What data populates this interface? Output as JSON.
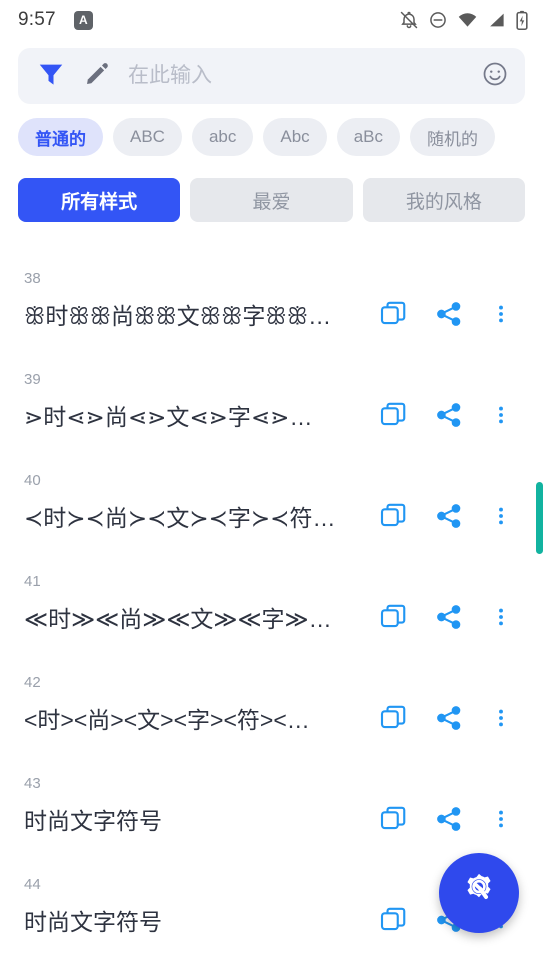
{
  "status_bar": {
    "time": "9:57",
    "badge_letter": "A",
    "icons": [
      "bell-off-icon",
      "do-not-disturb-icon",
      "wifi-icon",
      "signal-icon",
      "battery-charging-icon"
    ]
  },
  "search": {
    "filter_icon": "filter-funnel-icon",
    "pencil_icon": "pencil-icon",
    "placeholder": "在此输入",
    "value": "",
    "emoji_icon": "smiley-icon"
  },
  "chips": [
    {
      "label": "普通的",
      "selected": true
    },
    {
      "label": "ABC",
      "selected": false
    },
    {
      "label": "abc",
      "selected": false
    },
    {
      "label": "Abc",
      "selected": false
    },
    {
      "label": "aBc",
      "selected": false
    },
    {
      "label": "随机的",
      "selected": false
    }
  ],
  "tabs": [
    {
      "label": "所有样式",
      "selected": true
    },
    {
      "label": "最爱",
      "selected": false
    },
    {
      "label": "我的风格",
      "selected": false
    }
  ],
  "list": [
    {
      "index": "38",
      "text": "ꕥ时ꕥꕥ尚ꕥꕥ文ꕥꕥ字ꕥꕥ符ꕥꕥ…"
    },
    {
      "index": "39",
      "text": "⋗时⋖⋗尚⋖⋗文⋖⋗字⋖⋗…"
    },
    {
      "index": "40",
      "text": "≺时≻≺尚≻≺文≻≺字≻≺符≻≺…"
    },
    {
      "index": "41",
      "text": "≪时≫≪尚≫≪文≫≪字≫…"
    },
    {
      "index": "42",
      "text": "<时><尚><文><字><符><…"
    },
    {
      "index": "43",
      "text": "时尚文字符号"
    },
    {
      "index": "44",
      "text": "时尚文字符号"
    }
  ],
  "row_actions": {
    "copy_icon": "copy-icon",
    "share_icon": "share-icon",
    "menu_icon": "more-vertical-icon"
  },
  "fab": {
    "icon": "gear-wrench-icon"
  },
  "colors": {
    "accent_blue": "#3355f5",
    "action_blue": "#2196f3",
    "chip_selected_bg": "#dfe3fb",
    "scroll_thumb": "#12b3a0",
    "fab_bg": "#2f49ed"
  }
}
